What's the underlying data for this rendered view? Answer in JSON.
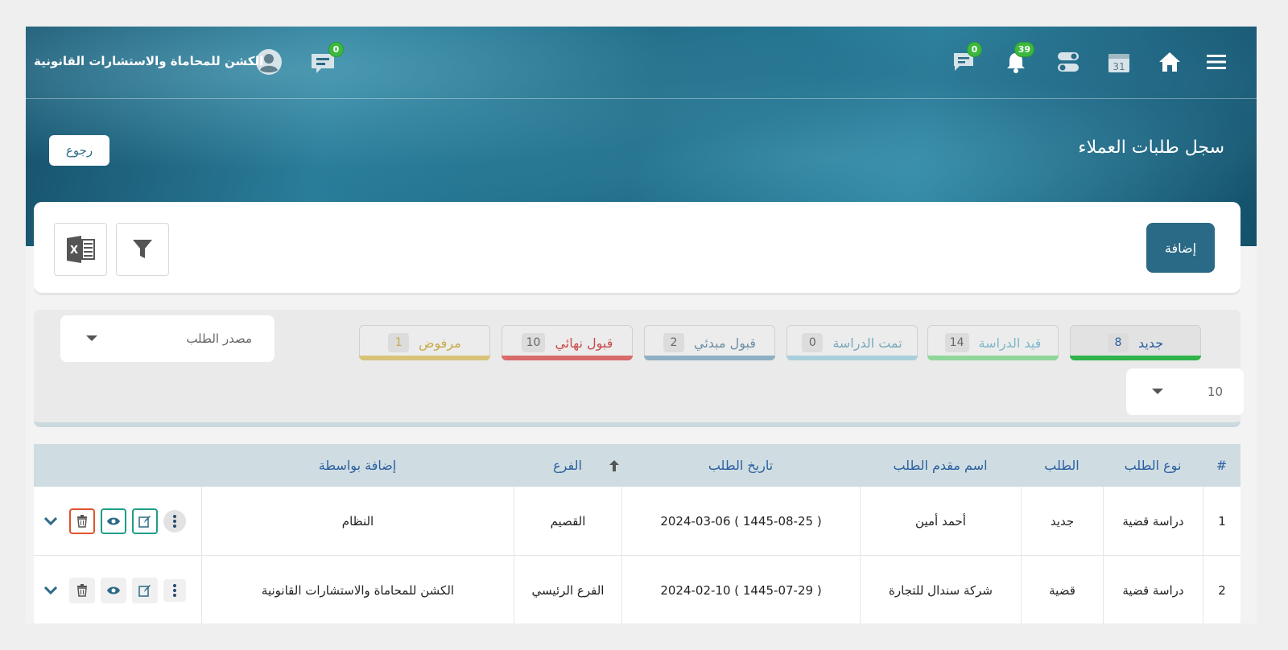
{
  "app": {
    "org_name": "الكشن للمحاماة والاستشارات القانونية",
    "page_title": "سجل طلبات العملاء",
    "back_label": "رجوع",
    "add_label": "إضافة"
  },
  "topbar": {
    "messages_count": "0",
    "chat_count": "0",
    "notifications_count": "39",
    "calendar_day": "31"
  },
  "status_tabs": [
    {
      "label": "جديد",
      "count": "8",
      "color": "#2fb34a",
      "text_color": "#2b5fa0"
    },
    {
      "label": "قيد الدراسة",
      "count": "14",
      "color": "#8fd69a",
      "text_color": "#7bb8c8"
    },
    {
      "label": "تمت الدراسة",
      "count": "0",
      "color": "#a9cfdc",
      "text_color": "#7aa8b8"
    },
    {
      "label": "قبول مبدئي",
      "count": "2",
      "color": "#8fb0c4",
      "text_color": "#6d8fa5"
    },
    {
      "label": "قبول نهائي",
      "count": "10",
      "color": "#d96b6b",
      "text_color": "#c94a4a"
    },
    {
      "label": "مرفوض",
      "count": "1",
      "color": "#d9c27a",
      "text_color": "#c8a94a"
    }
  ],
  "filters": {
    "source_placeholder": "مصدر الطلب",
    "page_size": "10"
  },
  "table": {
    "headers": {
      "index": "#",
      "type": "نوع الطلب",
      "request": "الطلب",
      "applicant": "اسم مقدم الطلب",
      "date": "تاريخ الطلب",
      "branch": "الفرع",
      "added_by": "إضافة بواسطة"
    },
    "rows": [
      {
        "index": "1",
        "type": "دراسة قضية",
        "request": "جديد",
        "applicant": "أحمد أمين",
        "date": "2024-03-06 ( 1445-08-25 )",
        "branch": "القصيم",
        "added_by": "النظام"
      },
      {
        "index": "2",
        "type": "دراسة قضية",
        "request": "قضية",
        "applicant": "شركة سندال للتجارة",
        "date": "2024-02-10 ( 1445-07-29 )",
        "branch": "الفرع الرئيسي",
        "added_by": "الكشن للمحاماة والاستشارات القانونية"
      }
    ]
  },
  "colors": {
    "primary": "#2b6a86",
    "badge": "#3cb83f",
    "header_text": "#2b5fa0"
  }
}
